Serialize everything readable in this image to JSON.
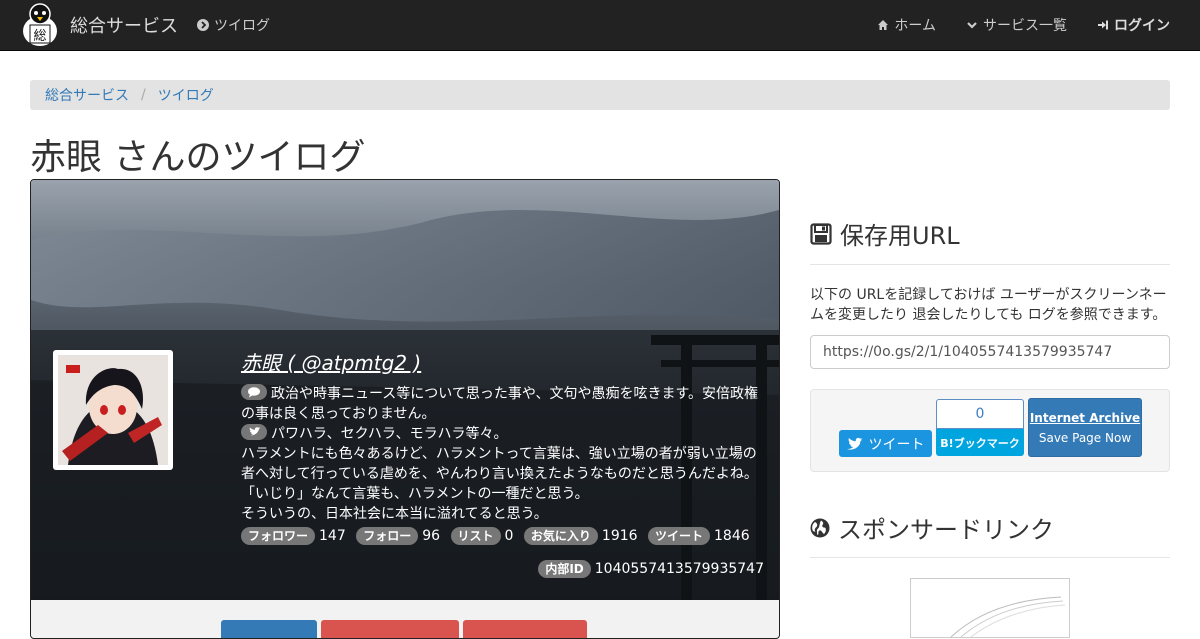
{
  "navbar": {
    "brand": "総合サービス",
    "left_link": "ツイログ",
    "right_items": [
      {
        "label": "ホーム",
        "icon": "home-icon"
      },
      {
        "label": "サービス一覧",
        "icon": "chevron-down-icon"
      },
      {
        "label": "ログイン",
        "icon": "sign-in-icon"
      }
    ]
  },
  "breadcrumb": {
    "items": [
      "総合サービス",
      "ツイログ"
    ]
  },
  "page_title": "赤眼 さんのツイログ",
  "profile": {
    "name": "赤眼 ( @atpmtg2 )",
    "bio_line1": "政治や時事ニュース等について思った事や、文句や愚痴を呟きます。安倍政権の事は良く思っておりません。",
    "bio_line2": "パワハラ、セクハラ、モラハラ等々。",
    "bio_line3": "ハラメントにも色々あるけど、ハラメントって言葉は、強い立場の者が弱い立場の者へ対して行っている虐めを、やんわり言い換えたようなものだと思うんだよね。",
    "bio_line4": "「いじり」なんて言葉も、ハラメントの一種だと思う。",
    "bio_line5": "そういうの、日本社会に本当に溢れてると思う。",
    "stats": [
      {
        "label": "フォロワー",
        "value": "147"
      },
      {
        "label": "フォロー",
        "value": "96"
      },
      {
        "label": "リスト",
        "value": "0"
      },
      {
        "label": "お気に入り",
        "value": "1916"
      },
      {
        "label": "ツイート",
        "value": "1846"
      }
    ],
    "internal_id_label": "内部ID",
    "internal_id": "1040557413579935747"
  },
  "sidebar": {
    "save_heading": "保存用URL",
    "save_desc": "以下の URLを記録しておけば ユーザーがスクリーンネームを変更したり 退会したりしても ログを参照できます。",
    "save_url": "https://0o.gs/2/1/1040557413579935747",
    "tweet_label": "ツイート",
    "hatena_count": "0",
    "hatena_label": "B!ブックマーク",
    "ia_title": "Internet Archive",
    "ia_sub": "Save Page Now",
    "sponsor_heading": "スポンサードリンク"
  },
  "colors": {
    "navbar": "#222222",
    "link": "#337ab7",
    "twitter": "#1b95e0",
    "hatena": "#00a4de",
    "badge": "#777777"
  }
}
